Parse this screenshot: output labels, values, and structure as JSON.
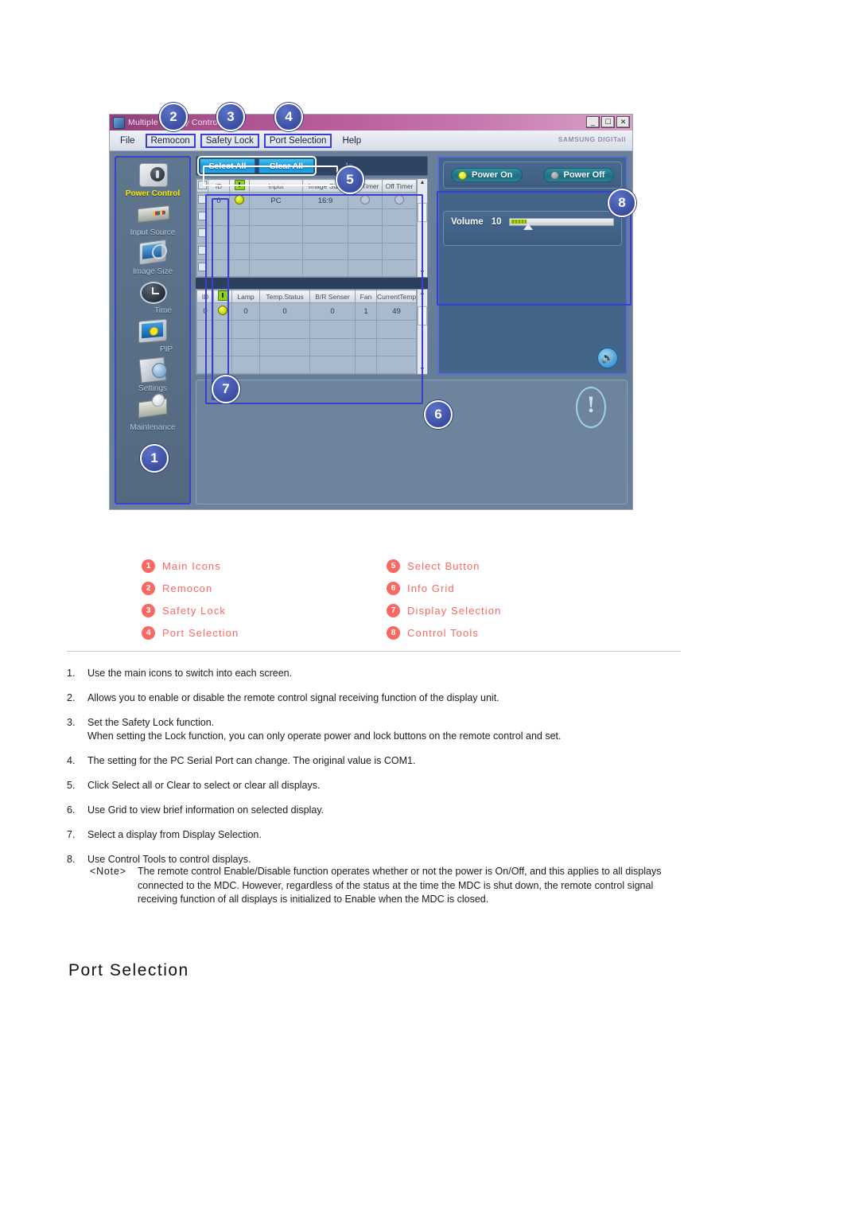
{
  "app": {
    "title": "Multiple Display Control",
    "window_controls": [
      "minimize",
      "maximize",
      "close"
    ],
    "brand_logo": "SAMSUNG DIGITall",
    "menu": [
      {
        "label": "File",
        "highlighted": false
      },
      {
        "label": "Remocon",
        "highlighted": true
      },
      {
        "label": "Safety Lock",
        "highlighted": true
      },
      {
        "label": "Port Selection",
        "highlighted": true
      },
      {
        "label": "Help",
        "highlighted": false
      }
    ],
    "sidebar": {
      "items": [
        {
          "label": "Power Control",
          "icon": "power-control-icon",
          "active": true
        },
        {
          "label": "Input Source",
          "icon": "input-source-icon",
          "active": false
        },
        {
          "label": "Image Size",
          "icon": "image-size-icon",
          "active": false
        },
        {
          "label": "Time",
          "icon": "time-icon",
          "active": false
        },
        {
          "label": "PIP",
          "icon": "pip-icon",
          "active": false
        },
        {
          "label": "Settings",
          "icon": "settings-icon",
          "active": false
        },
        {
          "label": "Maintenance",
          "icon": "maintenance-icon",
          "active": false
        }
      ]
    },
    "select_bar": {
      "select_all": "Select All",
      "clear_all": "Clear All",
      "partial_label": "le"
    },
    "grid_top": {
      "headers": [
        "",
        "ID",
        "",
        "Input",
        "Image Size",
        "On Timer",
        "Off Timer"
      ],
      "power_header_icon": "power-icon",
      "rows": [
        {
          "checked": false,
          "id": "0",
          "power": "on",
          "input": "PC",
          "image_size": "16:9",
          "on_timer": "off",
          "off_timer": "off"
        },
        {
          "checked": false,
          "id": "",
          "power": "",
          "input": "",
          "image_size": "",
          "on_timer": "",
          "off_timer": ""
        },
        {
          "checked": false,
          "id": "",
          "power": "",
          "input": "",
          "image_size": "",
          "on_timer": "",
          "off_timer": ""
        },
        {
          "checked": false,
          "id": "",
          "power": "",
          "input": "",
          "image_size": "",
          "on_timer": "",
          "off_timer": ""
        },
        {
          "checked": false,
          "id": "",
          "power": "",
          "input": "",
          "image_size": "",
          "on_timer": "",
          "off_timer": ""
        }
      ]
    },
    "grid_bottom": {
      "headers": [
        "ID",
        "",
        "Lamp",
        "Temp.Status",
        "B/R Senser",
        "Fan",
        "CurrentTemp."
      ],
      "power_header_icon": "power-icon",
      "rows": [
        {
          "id": "0",
          "power": "on",
          "lamp": "0",
          "temp_status": "0",
          "br_senser": "0",
          "fan": "1",
          "current_temp": "49"
        },
        {
          "id": "",
          "power": "",
          "lamp": "",
          "temp_status": "",
          "br_senser": "",
          "fan": "",
          "current_temp": ""
        },
        {
          "id": "",
          "power": "",
          "lamp": "",
          "temp_status": "",
          "br_senser": "",
          "fan": "",
          "current_temp": ""
        },
        {
          "id": "",
          "power": "",
          "lamp": "",
          "temp_status": "",
          "br_senser": "",
          "fan": "",
          "current_temp": ""
        }
      ]
    },
    "control_tools": {
      "power_on": "Power On",
      "power_off": "Power Off",
      "volume_label": "Volume",
      "volume_value": "10",
      "speaker_icon": "speaker-icon"
    },
    "info_panel": {
      "icon": "exclamation-icon"
    }
  },
  "callouts": [
    {
      "number": "1",
      "target": "main-icons"
    },
    {
      "number": "2",
      "target": "remocon"
    },
    {
      "number": "3",
      "target": "safety-lock"
    },
    {
      "number": "4",
      "target": "port-selection"
    },
    {
      "number": "5",
      "target": "select-button"
    },
    {
      "number": "6",
      "target": "info-grid"
    },
    {
      "number": "7",
      "target": "display-selection"
    },
    {
      "number": "8",
      "target": "control-tools"
    }
  ],
  "legend": {
    "left": [
      {
        "num": "1",
        "label": "Main Icons"
      },
      {
        "num": "2",
        "label": "Remocon"
      },
      {
        "num": "3",
        "label": "Safety Lock"
      },
      {
        "num": "4",
        "label": "Port Selection"
      }
    ],
    "right": [
      {
        "num": "5",
        "label": "Select Button"
      },
      {
        "num": "6",
        "label": "Info Grid"
      },
      {
        "num": "7",
        "label": "Display Selection"
      },
      {
        "num": "8",
        "label": "Control Tools"
      }
    ],
    "badge_color": "#fa6861"
  },
  "instructions": [
    {
      "num": "1.",
      "text": "Use the main icons to switch into each screen.",
      "line2": ""
    },
    {
      "num": "2.",
      "text": "Allows you to enable or disable the remote control signal receiving function of the display unit.",
      "line2": ""
    },
    {
      "num": "3.",
      "text": "Set the Safety Lock function.",
      "line2": "When setting the Lock function, you can only operate power and lock buttons on the remote control and set."
    },
    {
      "num": "4.",
      "text": "The setting for the PC Serial Port can change. The original value is COM1.",
      "line2": ""
    },
    {
      "num": "5.",
      "text": "Click Select all or Clear to select or clear all displays.",
      "line2": ""
    },
    {
      "num": "6.",
      "text": "Use Grid to view brief information on selected display.",
      "line2": ""
    },
    {
      "num": "7.",
      "text": "Select a display from Display Selection.",
      "line2": ""
    },
    {
      "num": "8.",
      "text": "Use Control Tools to control displays.",
      "line2": ""
    }
  ],
  "note": {
    "label": "<Note>",
    "text": "The remote control Enable/Disable function operates whether or not the power is On/Off, and this applies to all displays connected to the MDC. However, regardless of the status at the time the MDC is shut down, the remote control signal receiving function of all displays is initialized to Enable when the MDC is closed."
  },
  "section_heading": "Port Selection"
}
